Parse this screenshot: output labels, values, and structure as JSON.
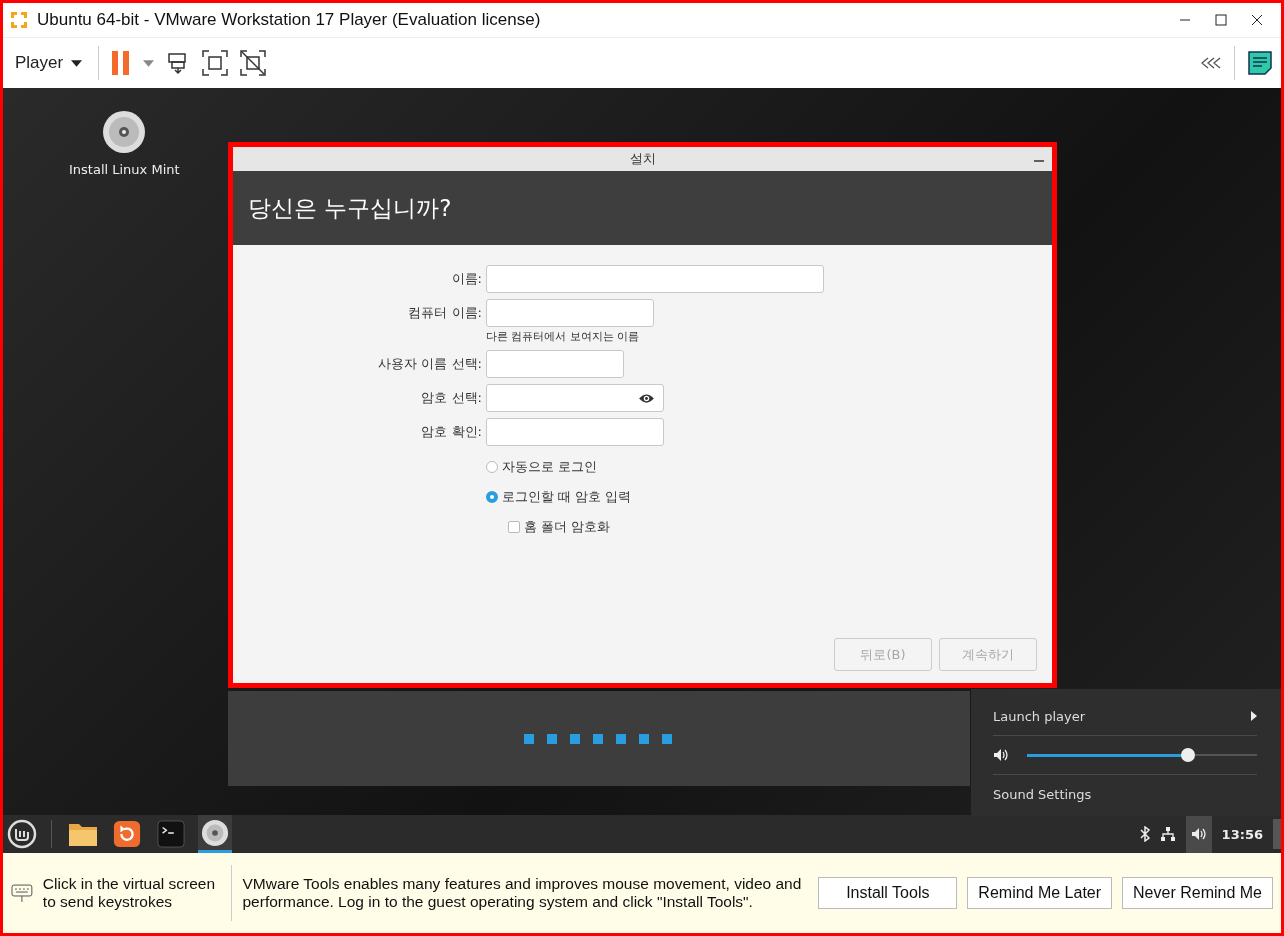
{
  "window": {
    "title": "Ubuntu 64-bit - VMware Workstation 17 Player (Evaluation license)"
  },
  "toolbar": {
    "player_menu": "Player"
  },
  "desktop": {
    "icons": [
      {
        "label": "Install Linux Mint"
      }
    ]
  },
  "installer": {
    "title": "설치",
    "heading": "당신은 누구십니까?",
    "fields": [
      {
        "label": "이름:"
      },
      {
        "label": "컴퓨터 이름:",
        "hint": "다른 컴퓨터에서 보여지는 이름"
      },
      {
        "label": "사용자 이름 선택:"
      },
      {
        "label": "암호 선택:",
        "reveal": true
      },
      {
        "label": "암호 확인:"
      }
    ],
    "login_options": [
      {
        "label": "자동으로 로그인",
        "selected": false
      },
      {
        "label": "로그인할 때 암호 입력",
        "selected": true
      }
    ],
    "encrypt_home": {
      "label": "홈 폴더 암호화",
      "checked": false
    },
    "buttons": [
      {
        "label": "뒤로(B)",
        "disabled": true
      },
      {
        "label": "계속하기",
        "disabled": true
      }
    ]
  },
  "sound_popup": {
    "launch_player": "Launch player",
    "volume": {
      "level": 0.7
    },
    "settings": "Sound Settings"
  },
  "taskbar": {
    "apps": [
      {
        "kind": "folder",
        "selected": false
      },
      {
        "kind": "update",
        "selected": false
      },
      {
        "kind": "terminal",
        "selected": false
      },
      {
        "kind": "disc",
        "selected": true
      }
    ],
    "clock": "13:56"
  },
  "notification": {
    "hint": "Click in the virtual screen to send keystrokes",
    "message": "VMware Tools enables many features and improves mouse movement, video and performance. Log in to the guest operating system and click \"Install Tools\".",
    "buttons": [
      "Install Tools",
      "Remind Me Later",
      "Never Remind Me"
    ]
  }
}
